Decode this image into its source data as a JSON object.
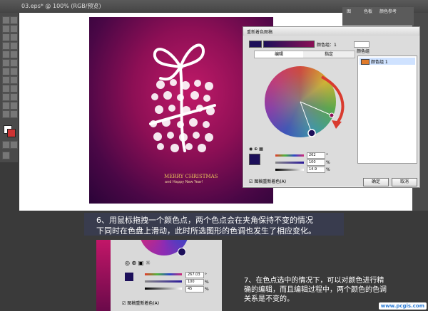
{
  "window": {
    "title": "03.eps* @ 100% (RGB/预览)"
  },
  "panel_tabs": [
    "图",
    "色板",
    "颜色参考"
  ],
  "artwork": {
    "headline": "MERRY CHRISTMAS",
    "subline": "and Happy New Year!"
  },
  "dialog": {
    "title": "重新着色图稿",
    "colors_label": "颜色组：1",
    "tabs": [
      "编辑",
      "指定"
    ],
    "color_groups_label": "颜色组",
    "color_group_item": "颜色组 1",
    "values": [
      "262",
      "100",
      "14.9"
    ],
    "units": [
      "°",
      "%",
      "%"
    ],
    "checkbox_label": "图稿重新着色(A)",
    "ok": "确定",
    "cancel": "取消"
  },
  "captions": {
    "step6": [
      "6、用鼠标拖拽一个颜色点，两个色点会在夹角保持不变的情况",
      "下同时在色盘上滑动，此时所选图形的色调也发生了相应变化。"
    ],
    "step7": [
      "7、在色点选中的情况下，可以对颜色进行精",
      "确的编辑，而且编辑过程中，两个颜色的色调",
      "关系是不变的。"
    ]
  },
  "inset": {
    "values": [
      "267.03",
      "100",
      "45"
    ],
    "units": [
      "°",
      "%",
      "%"
    ],
    "checkbox_label": "图稿重新着色(A)"
  },
  "watermark": {
    "text": "www.pcgis.com"
  },
  "colors": {
    "arrow": "#d93b2f",
    "swatch": "#1c0f5a",
    "accent": "#2a7bd6"
  }
}
